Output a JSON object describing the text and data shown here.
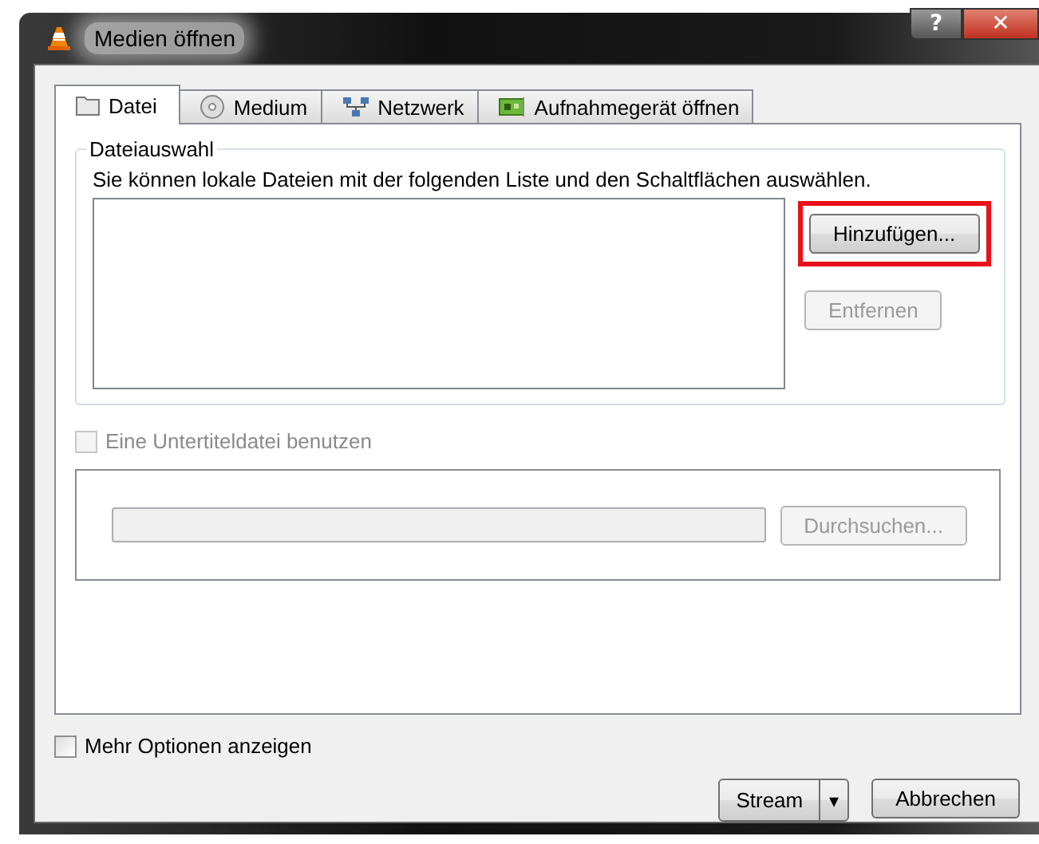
{
  "window": {
    "title": "Medien öffnen",
    "help_button": "?",
    "close_button": "✕"
  },
  "tabs": [
    {
      "label": "Datei",
      "selected": true
    },
    {
      "label": "Medium",
      "selected": false
    },
    {
      "label": "Netzwerk",
      "selected": false
    },
    {
      "label": "Aufnahmegerät öffnen",
      "selected": false
    }
  ],
  "file_selection": {
    "title": "Dateiauswahl",
    "description": "Sie können lokale Dateien mit der folgenden Liste und den Schaltflächen auswählen.",
    "buttons": [
      {
        "label": "Hinzufügen...",
        "disabled": false,
        "highlighted": true
      },
      {
        "label": "Entfernen",
        "disabled": true,
        "highlighted": false
      }
    ]
  },
  "subtitle": {
    "label": "Eine Untertiteldatei benutzen",
    "checked": false,
    "disabled": true,
    "field_disabled": true,
    "browse_button": {
      "label": "Durchsuchen...",
      "disabled": true
    }
  },
  "more_options": {
    "label": "Mehr Optionen anzeigen",
    "checked": false
  },
  "footer_buttons": [
    {
      "label": "Stream",
      "kind": "split",
      "caret": "▾"
    },
    {
      "label": "Abbrechen",
      "kind": "plain"
    }
  ]
}
